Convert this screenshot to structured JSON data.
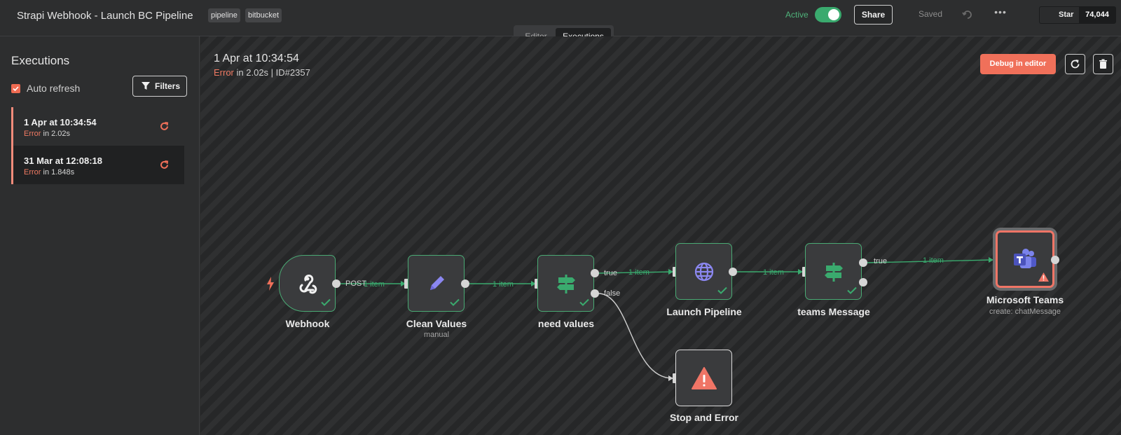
{
  "header": {
    "workflow_title": "Strapi Webhook - Launch BC Pipeline",
    "tags": [
      "pipeline",
      "bitbucket"
    ],
    "active_label": "Active",
    "active": true,
    "share_label": "Share",
    "saved_label": "Saved",
    "github": {
      "star_label": "Star",
      "count": "74,044"
    }
  },
  "mode_switch": {
    "editor": "Editor",
    "executions": "Executions",
    "selected": "Executions"
  },
  "sidebar": {
    "title": "Executions",
    "auto_refresh_label": "Auto refresh",
    "auto_refresh_checked": true,
    "filters_label": "Filters",
    "executions": [
      {
        "when": "1 Apr at 10:34:54",
        "status": "Error",
        "duration": "in 2.02s",
        "selected": false
      },
      {
        "when": "31 Mar at 12:08:18",
        "status": "Error",
        "duration": "in 1.848s",
        "selected": true
      }
    ]
  },
  "execution": {
    "date": "1 Apr at 10:34:54",
    "status": "Error",
    "details": "in 2.02s | ID#2357",
    "debug_label": "Debug in editor"
  },
  "nodes": {
    "webhook": {
      "name": "Webhook",
      "output_label": "POST"
    },
    "clean_values": {
      "name": "Clean Values",
      "subtitle": "manual"
    },
    "need_values": {
      "name": "need values",
      "true_label": "true",
      "false_label": "false"
    },
    "launch_pipeline": {
      "name": "Launch Pipeline"
    },
    "teams_message": {
      "name": "teams Message",
      "true_label": "true"
    },
    "microsoft_teams": {
      "name": "Microsoft Teams",
      "subtitle": "create: chatMessage"
    },
    "stop_and_error": {
      "name": "Stop and Error"
    }
  },
  "connections": {
    "item_label": "1 item"
  },
  "colors": {
    "accent": "#f0705a",
    "success": "#3aaa6e",
    "error": "#f07566"
  }
}
